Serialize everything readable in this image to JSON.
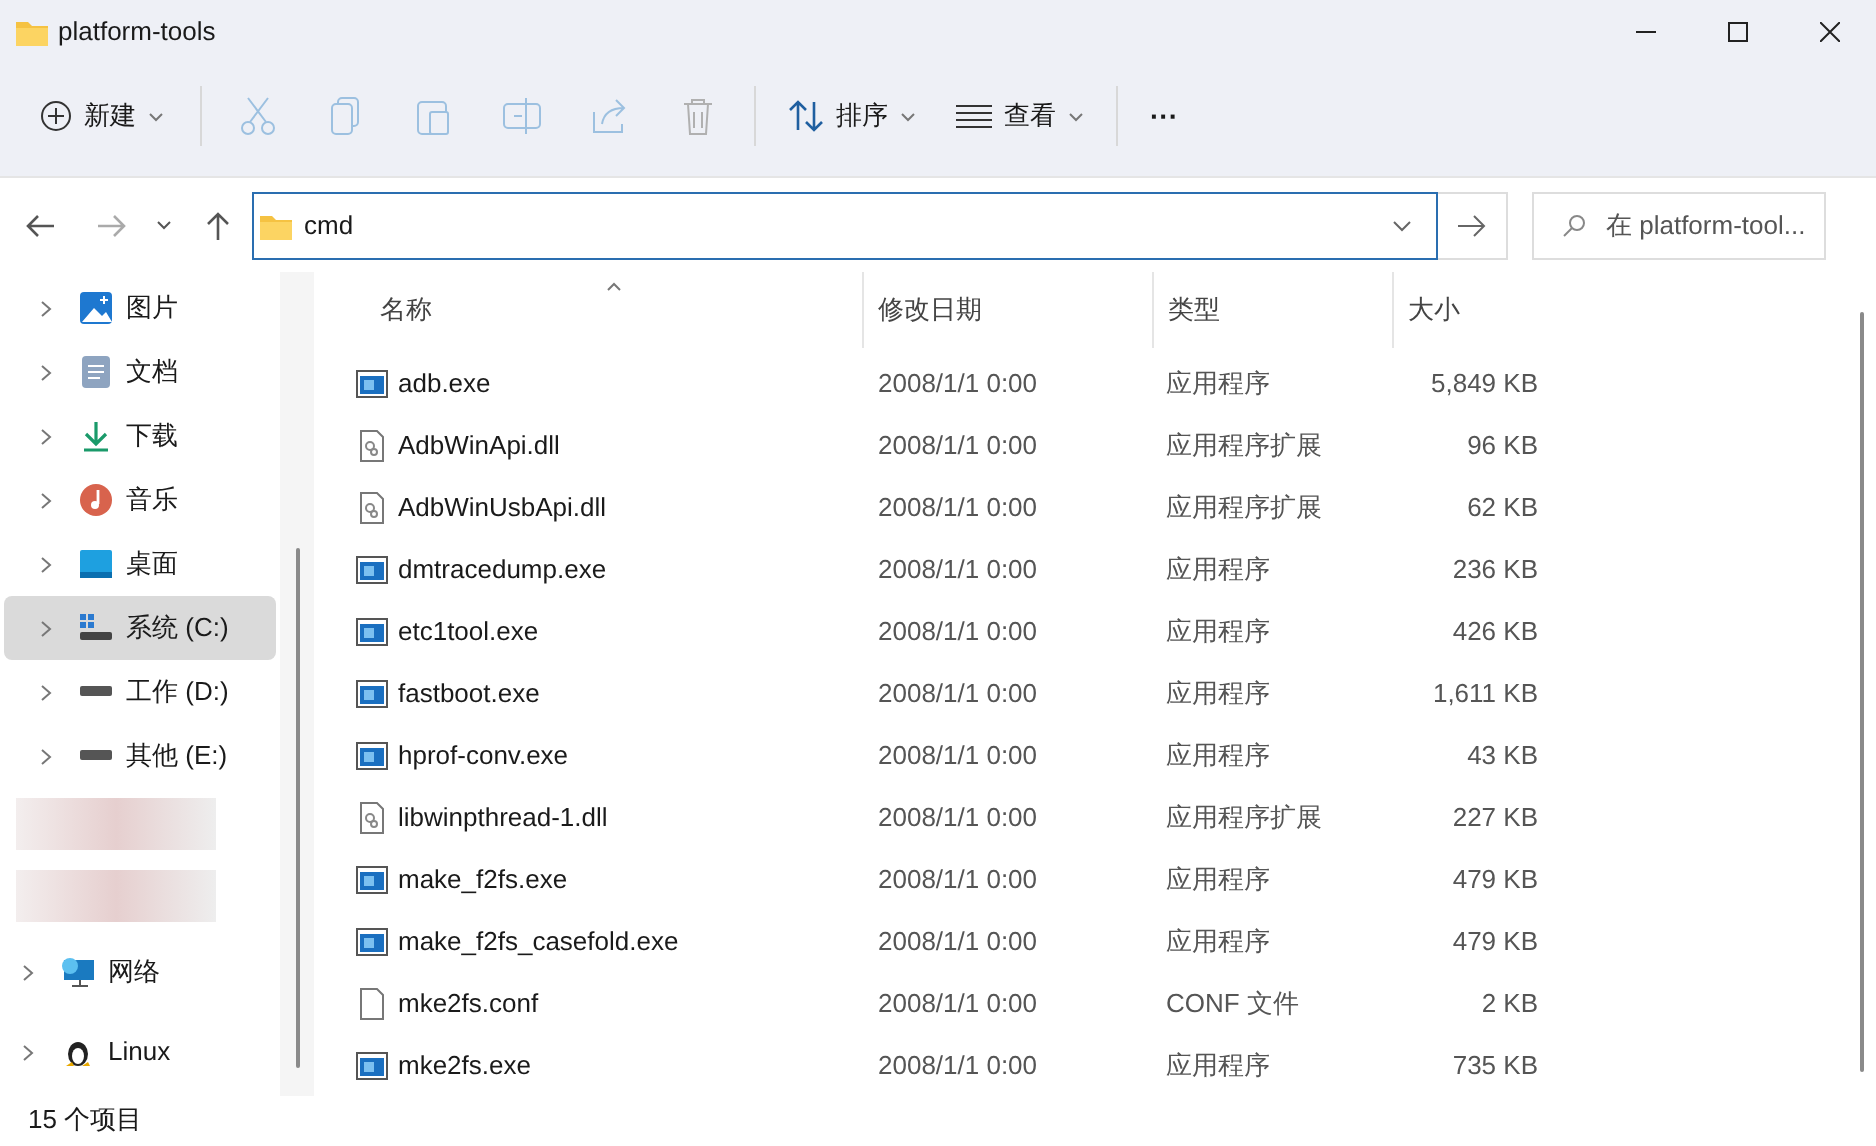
{
  "window": {
    "title": "platform-tools"
  },
  "toolbar": {
    "new": "新建",
    "sort": "排序",
    "view": "查看",
    "more": "···"
  },
  "address_bar": {
    "value": "cmd"
  },
  "search": {
    "placeholder": "在 platform-tool..."
  },
  "sidebar": {
    "items": [
      {
        "kind": "pictures",
        "label": "图片",
        "selected": false
      },
      {
        "kind": "documents",
        "label": "文档",
        "selected": false
      },
      {
        "kind": "downloads",
        "label": "下载",
        "selected": false
      },
      {
        "kind": "music",
        "label": "音乐",
        "selected": false
      },
      {
        "kind": "desktop",
        "label": "桌面",
        "selected": false
      },
      {
        "kind": "system-drive",
        "label": "系统 (C:)",
        "selected": true
      },
      {
        "kind": "drive",
        "label": "工作 (D:)",
        "selected": false
      },
      {
        "kind": "drive",
        "label": "其他 (E:)",
        "selected": false
      },
      {
        "kind": "blurred"
      },
      {
        "kind": "blurred"
      },
      {
        "kind": "network",
        "label": "网络",
        "selected": false
      },
      {
        "kind": "linux",
        "label": "Linux",
        "selected": false
      }
    ]
  },
  "table": {
    "columns": [
      "名称",
      "修改日期",
      "类型",
      "大小"
    ],
    "rows": [
      {
        "kind": "exe",
        "name": "adb.exe",
        "date": "2008/1/1 0:00",
        "type": "应用程序",
        "size": "5,849 KB"
      },
      {
        "kind": "dll",
        "name": "AdbWinApi.dll",
        "date": "2008/1/1 0:00",
        "type": "应用程序扩展",
        "size": "96 KB"
      },
      {
        "kind": "dll",
        "name": "AdbWinUsbApi.dll",
        "date": "2008/1/1 0:00",
        "type": "应用程序扩展",
        "size": "62 KB"
      },
      {
        "kind": "exe",
        "name": "dmtracedump.exe",
        "date": "2008/1/1 0:00",
        "type": "应用程序",
        "size": "236 KB"
      },
      {
        "kind": "exe",
        "name": "etc1tool.exe",
        "date": "2008/1/1 0:00",
        "type": "应用程序",
        "size": "426 KB"
      },
      {
        "kind": "exe",
        "name": "fastboot.exe",
        "date": "2008/1/1 0:00",
        "type": "应用程序",
        "size": "1,611 KB"
      },
      {
        "kind": "exe",
        "name": "hprof-conv.exe",
        "date": "2008/1/1 0:00",
        "type": "应用程序",
        "size": "43 KB"
      },
      {
        "kind": "dll",
        "name": "libwinpthread-1.dll",
        "date": "2008/1/1 0:00",
        "type": "应用程序扩展",
        "size": "227 KB"
      },
      {
        "kind": "exe",
        "name": "make_f2fs.exe",
        "date": "2008/1/1 0:00",
        "type": "应用程序",
        "size": "479 KB"
      },
      {
        "kind": "exe",
        "name": "make_f2fs_casefold.exe",
        "date": "2008/1/1 0:00",
        "type": "应用程序",
        "size": "479 KB"
      },
      {
        "kind": "file",
        "name": "mke2fs.conf",
        "date": "2008/1/1 0:00",
        "type": "CONF 文件",
        "size": "2 KB"
      },
      {
        "kind": "exe",
        "name": "mke2fs.exe",
        "date": "2008/1/1 0:00",
        "type": "应用程序",
        "size": "735 KB"
      }
    ]
  },
  "status_bar": {
    "count": "15 个项目"
  }
}
